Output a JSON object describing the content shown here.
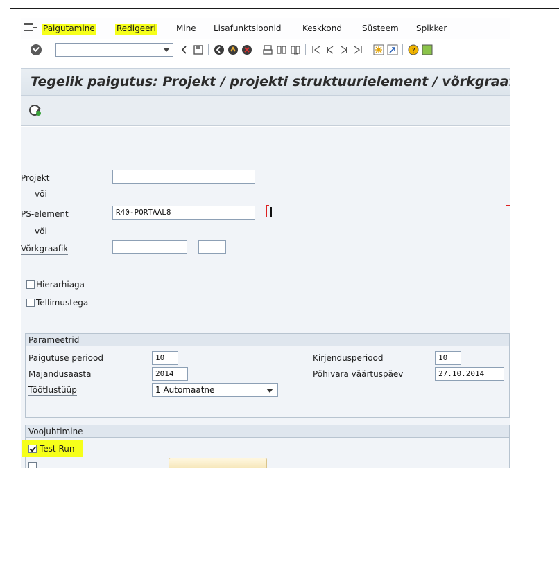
{
  "menu": {
    "items": [
      "Paigutamine",
      "Redigeeri",
      "Mine",
      "Lisafunktsioonid",
      "Keskkond",
      "Süsteem",
      "Spikker"
    ]
  },
  "toolbar": {
    "command_value": ""
  },
  "title": "Tegelik paigutus: Projekt / projekti struktuurielement / võrkgraafi",
  "selection": {
    "projekt_label": "Projekt",
    "projekt_value": "",
    "voi_1": "või",
    "ps_element_label": "PS-element",
    "ps_element_value": "R40-PORTAAL8",
    "voi_2": "või",
    "vorkgraafik_label": "Võrkgraafik",
    "vorkgraafik_value": "",
    "vorkgraafik_value2": "",
    "hierarhiaga_label": "Hierarhiaga",
    "tellimustega_label": "Tellimustega"
  },
  "parameetrid": {
    "title": "Parameetrid",
    "paigutuse_periood_label": "Paigutuse periood",
    "paigutuse_periood_value": "10",
    "majandusaasta_label": "Majandusaasta",
    "majandusaasta_value": "2014",
    "tootlustuup_label": "Töötlustüüp",
    "tootlustuup_value": "1 Automaatne",
    "kirjendusperiood_label": "Kirjendusperiood",
    "kirjendusperiood_value": "10",
    "pohivara_label": "Põhivara väärtuspäev",
    "pohivara_value": "27.10.2014"
  },
  "voojuhtimine": {
    "title": "Voojuhtimine",
    "test_run_label": "Test Run",
    "test_run_checked": true
  },
  "colors": {
    "highlight": "#f6ff1a",
    "panel_bg": "#f1f4f8",
    "title_bg": "#e9eef3",
    "required_marker": "#dd2222"
  }
}
